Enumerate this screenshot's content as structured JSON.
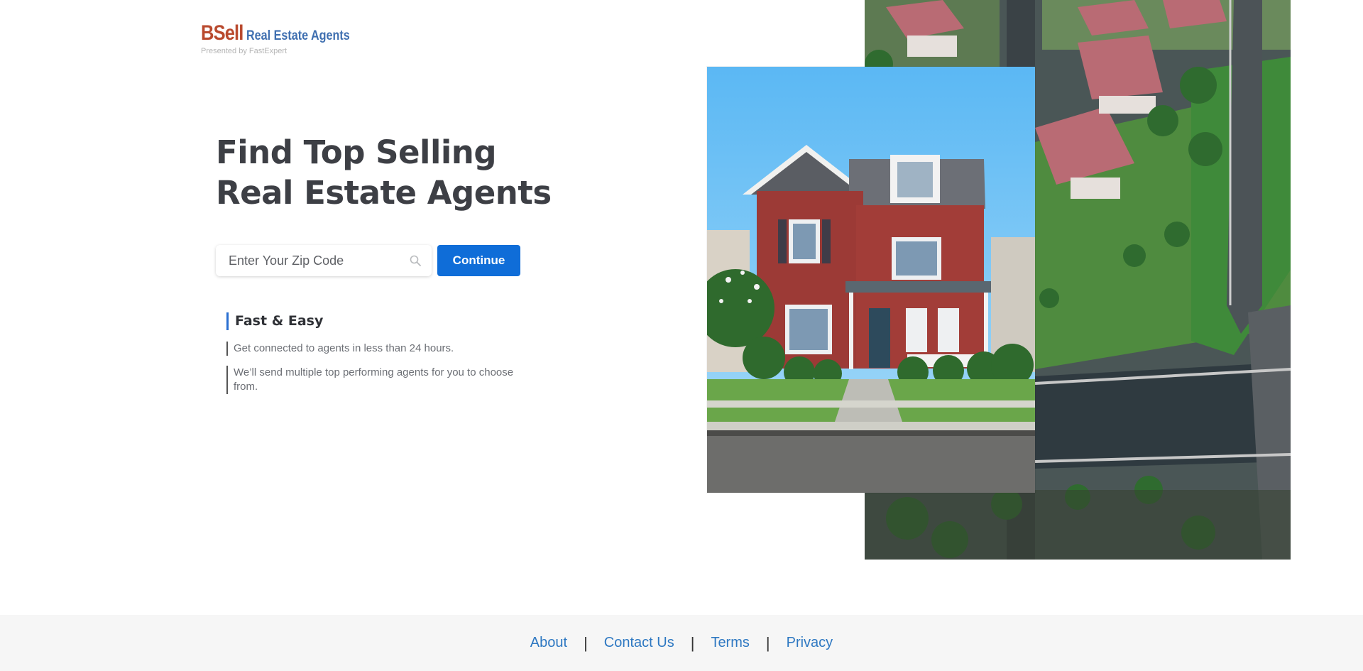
{
  "logo": {
    "brand": "BSell",
    "tagline": "Real Estate Agents",
    "presented_by": "Presented by FastExpert"
  },
  "hero": {
    "headline_line1": "Find Top Selling",
    "headline_line2": "Real Estate Agents"
  },
  "search": {
    "placeholder": "Enter Your Zip Code",
    "value": "",
    "icon": "search-icon",
    "button_label": "Continue"
  },
  "features": {
    "title": "Fast & Easy",
    "items": [
      "Get connected to agents in less than 24 hours.",
      "We’ll send multiple top performing agents for you to choose from."
    ]
  },
  "footer": {
    "links": [
      "About",
      "Contact Us",
      "Terms",
      "Privacy"
    ],
    "separator": "|"
  },
  "colors": {
    "accent": "#0f6dd8",
    "brand_red": "#b94a2e",
    "brand_blue": "#3f6fb0",
    "heading": "#3d3f45",
    "link": "#2e78c2",
    "footer_bg": "#f6f6f6"
  }
}
